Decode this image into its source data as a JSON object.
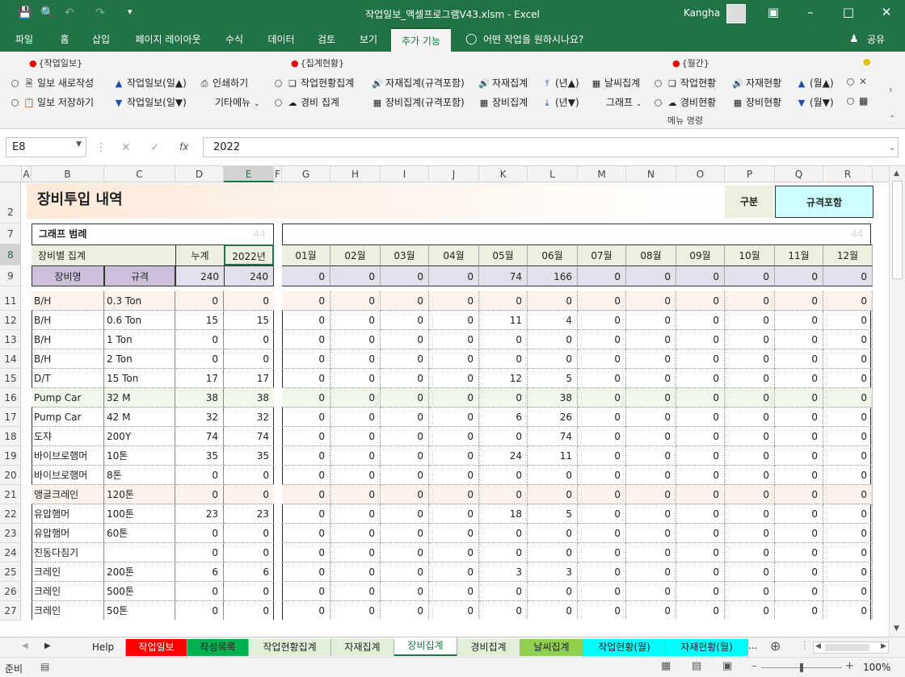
{
  "titlebar": {
    "doc_title": "작업일보_액셀프로그램V43.xlsm  -  Excel",
    "user": "Kangha"
  },
  "menu": {
    "tabs": [
      "파일",
      "홈",
      "삽입",
      "페이지 레이아웃",
      "수식",
      "데이터",
      "검토",
      "보기",
      "추가 기능"
    ],
    "tell_me": "어떤 작업을 원하시나요?",
    "share": "공유",
    "active_index": 8
  },
  "ribbon": {
    "group1": {
      "title": "{작업일보}",
      "items": [
        "일보 새로작성",
        "작업일보(일▲)",
        "인쇄하기",
        "일보 저장하기",
        "작업일보(일▼)",
        "기타메뉴"
      ]
    },
    "group2": {
      "title": "{집계현황}",
      "items": [
        "작업현황집계",
        "자재집계(규격포함)",
        "자재집계",
        "(년▲)",
        "날씨집계",
        "경비 집계",
        "장비집계(규격포함)",
        "장비집계",
        "(년▼)",
        "그래프"
      ]
    },
    "group3": {
      "title": "{월간}",
      "items": [
        "작업현황",
        "자재현황",
        "(월▲)",
        "경비현황",
        "장비현황",
        "(월▼)"
      ]
    },
    "footer": "메뉴 명령"
  },
  "formula": {
    "name_box": "E8",
    "value": "2022",
    "fx": "fx"
  },
  "columns": [
    "A",
    "B",
    "C",
    "D",
    "E",
    "F",
    "G",
    "H",
    "I",
    "J",
    "K",
    "L",
    "M",
    "N",
    "O",
    "P",
    "Q",
    "R"
  ],
  "row_numbers": [
    "2",
    "7",
    "8",
    "9",
    "11",
    "12",
    "13",
    "14",
    "15",
    "16",
    "17",
    "18",
    "19",
    "20",
    "21",
    "22",
    "23",
    "24",
    "25",
    "26",
    "27"
  ],
  "sheet": {
    "title": "장비투입 내역",
    "gubun_label": "구분",
    "gubun_value": "규격포함",
    "legend_title": "그래프 범례",
    "faint_left": "44",
    "faint_right": "44",
    "header1": {
      "b": "장비별 집계",
      "d": "누계",
      "e": "2022년"
    },
    "header2": {
      "b": "장비명",
      "c": "규격",
      "d": "240",
      "e": "240"
    },
    "months": [
      "01월",
      "02월",
      "03월",
      "04월",
      "05월",
      "06월",
      "07월",
      "08월",
      "09월",
      "10월",
      "11월",
      "12월"
    ],
    "month_totals": [
      "0",
      "0",
      "0",
      "0",
      "74",
      "166",
      "0",
      "0",
      "0",
      "0",
      "0",
      "0"
    ],
    "rows": [
      {
        "name": "B/H",
        "spec": "0.3 Ton",
        "total": "0",
        "year": "0",
        "m": [
          "0",
          "0",
          "0",
          "0",
          "0",
          "0",
          "0",
          "0",
          "0",
          "0",
          "0",
          "0"
        ]
      },
      {
        "name": "B/H",
        "spec": "0.6 Ton",
        "total": "15",
        "year": "15",
        "m": [
          "0",
          "0",
          "0",
          "0",
          "11",
          "4",
          "0",
          "0",
          "0",
          "0",
          "0",
          "0"
        ]
      },
      {
        "name": "B/H",
        "spec": "1 Ton",
        "total": "0",
        "year": "0",
        "m": [
          "0",
          "0",
          "0",
          "0",
          "0",
          "0",
          "0",
          "0",
          "0",
          "0",
          "0",
          "0"
        ]
      },
      {
        "name": "B/H",
        "spec": "2 Ton",
        "total": "0",
        "year": "0",
        "m": [
          "0",
          "0",
          "0",
          "0",
          "0",
          "0",
          "0",
          "0",
          "0",
          "0",
          "0",
          "0"
        ]
      },
      {
        "name": "D/T",
        "spec": "15 Ton",
        "total": "17",
        "year": "17",
        "m": [
          "0",
          "0",
          "0",
          "0",
          "12",
          "5",
          "0",
          "0",
          "0",
          "0",
          "0",
          "0"
        ]
      },
      {
        "name": "Pump Car",
        "spec": "32 M",
        "total": "38",
        "year": "38",
        "m": [
          "0",
          "0",
          "0",
          "0",
          "0",
          "38",
          "0",
          "0",
          "0",
          "0",
          "0",
          "0"
        ]
      },
      {
        "name": "Pump Car",
        "spec": "42 M",
        "total": "32",
        "year": "32",
        "m": [
          "0",
          "0",
          "0",
          "0",
          "6",
          "26",
          "0",
          "0",
          "0",
          "0",
          "0",
          "0"
        ]
      },
      {
        "name": "도쟈",
        "spec": "200Y",
        "total": "74",
        "year": "74",
        "m": [
          "0",
          "0",
          "0",
          "0",
          "0",
          "74",
          "0",
          "0",
          "0",
          "0",
          "0",
          "0"
        ]
      },
      {
        "name": "바이브로햄머",
        "spec": "10톤",
        "total": "35",
        "year": "35",
        "m": [
          "0",
          "0",
          "0",
          "0",
          "24",
          "11",
          "0",
          "0",
          "0",
          "0",
          "0",
          "0"
        ]
      },
      {
        "name": "바이브로햄머",
        "spec": "8톤",
        "total": "0",
        "year": "0",
        "m": [
          "0",
          "0",
          "0",
          "0",
          "0",
          "0",
          "0",
          "0",
          "0",
          "0",
          "0",
          "0"
        ]
      },
      {
        "name": "앵글크레인",
        "spec": "120톤",
        "total": "0",
        "year": "0",
        "m": [
          "0",
          "0",
          "0",
          "0",
          "0",
          "0",
          "0",
          "0",
          "0",
          "0",
          "0",
          "0"
        ]
      },
      {
        "name": "유압햄머",
        "spec": "100톤",
        "total": "23",
        "year": "23",
        "m": [
          "0",
          "0",
          "0",
          "0",
          "18",
          "5",
          "0",
          "0",
          "0",
          "0",
          "0",
          "0"
        ]
      },
      {
        "name": "유압햄머",
        "spec": "60톤",
        "total": "0",
        "year": "0",
        "m": [
          "0",
          "0",
          "0",
          "0",
          "0",
          "0",
          "0",
          "0",
          "0",
          "0",
          "0",
          "0"
        ]
      },
      {
        "name": "진동다짐기",
        "spec": "",
        "total": "0",
        "year": "0",
        "m": [
          "0",
          "0",
          "0",
          "0",
          "0",
          "0",
          "0",
          "0",
          "0",
          "0",
          "0",
          "0"
        ]
      },
      {
        "name": "크레인",
        "spec": "200톤",
        "total": "6",
        "year": "6",
        "m": [
          "0",
          "0",
          "0",
          "0",
          "3",
          "3",
          "0",
          "0",
          "0",
          "0",
          "0",
          "0"
        ]
      },
      {
        "name": "크레인",
        "spec": "500톤",
        "total": "0",
        "year": "0",
        "m": [
          "0",
          "0",
          "0",
          "0",
          "0",
          "0",
          "0",
          "0",
          "0",
          "0",
          "0",
          "0"
        ]
      },
      {
        "name": "크레인",
        "spec": "50톤",
        "total": "0",
        "year": "0",
        "m": [
          "0",
          "0",
          "0",
          "0",
          "0",
          "0",
          "0",
          "0",
          "0",
          "0",
          "0",
          "0"
        ]
      }
    ]
  },
  "sheet_tabs": [
    {
      "label": "Help",
      "color": "#f3f3f3"
    },
    {
      "label": "작업일보",
      "color": "#ff0000"
    },
    {
      "label": "작성목록",
      "color": "#00b050"
    },
    {
      "label": "작업현황집계",
      "color": "#e2f0d9"
    },
    {
      "label": "자재집계",
      "color": "#e2f0d9"
    },
    {
      "label": "장비집계",
      "color": "#ffffff"
    },
    {
      "label": "경비집계",
      "color": "#e2f0d9"
    },
    {
      "label": "날씨집계",
      "color": "#92d050"
    },
    {
      "label": "작업현황(월)",
      "color": "#00ffff"
    },
    {
      "label": "자재현황(월)",
      "color": "#00ffff"
    }
  ],
  "status": {
    "ready": "준비",
    "zoom": "100%"
  }
}
